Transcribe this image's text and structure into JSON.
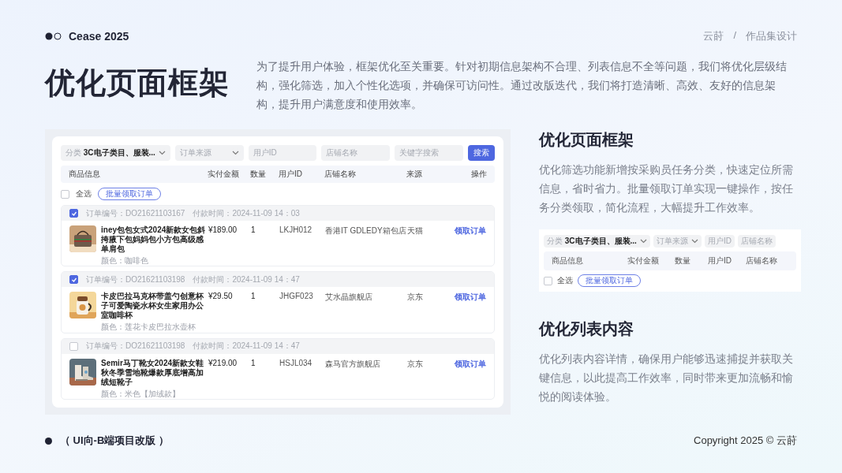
{
  "header": {
    "brand": "Cease 2025",
    "breadcrumb": [
      "云莳",
      "/",
      "作品集设计"
    ]
  },
  "hero": {
    "title": "优化页面框架",
    "intro": "为了提升用户体验，框架优化至关重要。针对初期信息架构不合理、列表信息不全等问题，我们将优化层级结构，强化筛选，加入个性化选项，并确保可访问性。通过改版迭代，我们将打造清晰、高效、友好的信息架构，提升用户满意度和使用效率。"
  },
  "mockup": {
    "filters": [
      {
        "kind": "select",
        "label": "分类",
        "value": "3C电子类目、服装..."
      },
      {
        "kind": "select",
        "placeholder": "订单来源"
      },
      {
        "kind": "input",
        "placeholder": "用户ID"
      },
      {
        "kind": "input",
        "placeholder": "店铺名称"
      },
      {
        "kind": "input",
        "placeholder": "关键字搜索"
      }
    ],
    "search_button": "搜索",
    "columns": [
      "商品信息",
      "实付金额",
      "数量",
      "用户ID",
      "店铺名称",
      "来源",
      "操作"
    ],
    "select_all": {
      "label": "全选",
      "checked": false
    },
    "batch_button": "批量领取订单",
    "orders": [
      {
        "checked": true,
        "order_no": "订单编号：DO21621103167",
        "paid_time": "付款时间：2024-11-09 14：03",
        "title": "iney包包女式2024新款女包斜挎腋下包妈妈包小方包高级感单肩包",
        "variant": "颜色：咖啡色",
        "price": "¥189.00",
        "qty": "1",
        "user_id": "LKJH012",
        "shop": "香港IT GDLEDY箱包店",
        "source": "天猫",
        "action": "领取订单"
      },
      {
        "checked": true,
        "order_no": "订单编号：DO21621103198",
        "paid_time": "付款时间：2024-11-09 14：47",
        "title": "卡皮巴拉马克杯带盖勺创意杯子可爱陶瓷水杯女生家用办公室咖啡杯",
        "variant": "颜色：莲花卡皮巴拉水壶杯",
        "price": "¥29.50",
        "qty": "1",
        "user_id": "JHGF023",
        "shop": "艾水晶旗舰店",
        "source": "京东",
        "action": "领取订单"
      },
      {
        "checked": false,
        "order_no": "订单编号：DO21621103198",
        "paid_time": "付款时间：2024-11-09 14：47",
        "title": "Semir马丁靴女2024新款女鞋秋冬季雪地靴爆款厚底增高加绒短靴子",
        "variant": "颜色：米色【加绒款】",
        "price": "¥219.00",
        "qty": "1",
        "user_id": "HSJL034",
        "shop": "森马官方旗舰店",
        "source": "京东",
        "action": "领取订单"
      }
    ]
  },
  "sections": [
    {
      "title": "优化页面框架",
      "text": "优化筛选功能新增按采购员任务分类，快速定位所需信息，省时省力。批量领取订单实现一键操作，按任务分类领取，简化流程，大幅提升工作效率。",
      "preview": {
        "filters": [
          {
            "kind": "select",
            "label": "分类",
            "value": "3C电子类目、服装..."
          },
          {
            "kind": "select",
            "placeholder": "订单来源"
          },
          {
            "kind": "input",
            "placeholder": "用户ID"
          },
          {
            "kind": "input",
            "placeholder": "店铺名称"
          }
        ],
        "columns": [
          "商品信息",
          "实付金额",
          "数量",
          "用户ID",
          "店铺名称"
        ],
        "select_all": {
          "label": "全选",
          "checked": false
        },
        "batch_button": "批量领取订单"
      }
    },
    {
      "title": "优化列表内容",
      "text": "优化列表内容详情，确保用户能够迅速捕捉并获取关键信息，以此提高工作效率，同时带来更加流畅和愉悦的阅读体验。"
    }
  ],
  "footer": {
    "project": "（ UI向-B端项目改版 ）",
    "copyright": "Copyright 2025 © 云莳"
  }
}
